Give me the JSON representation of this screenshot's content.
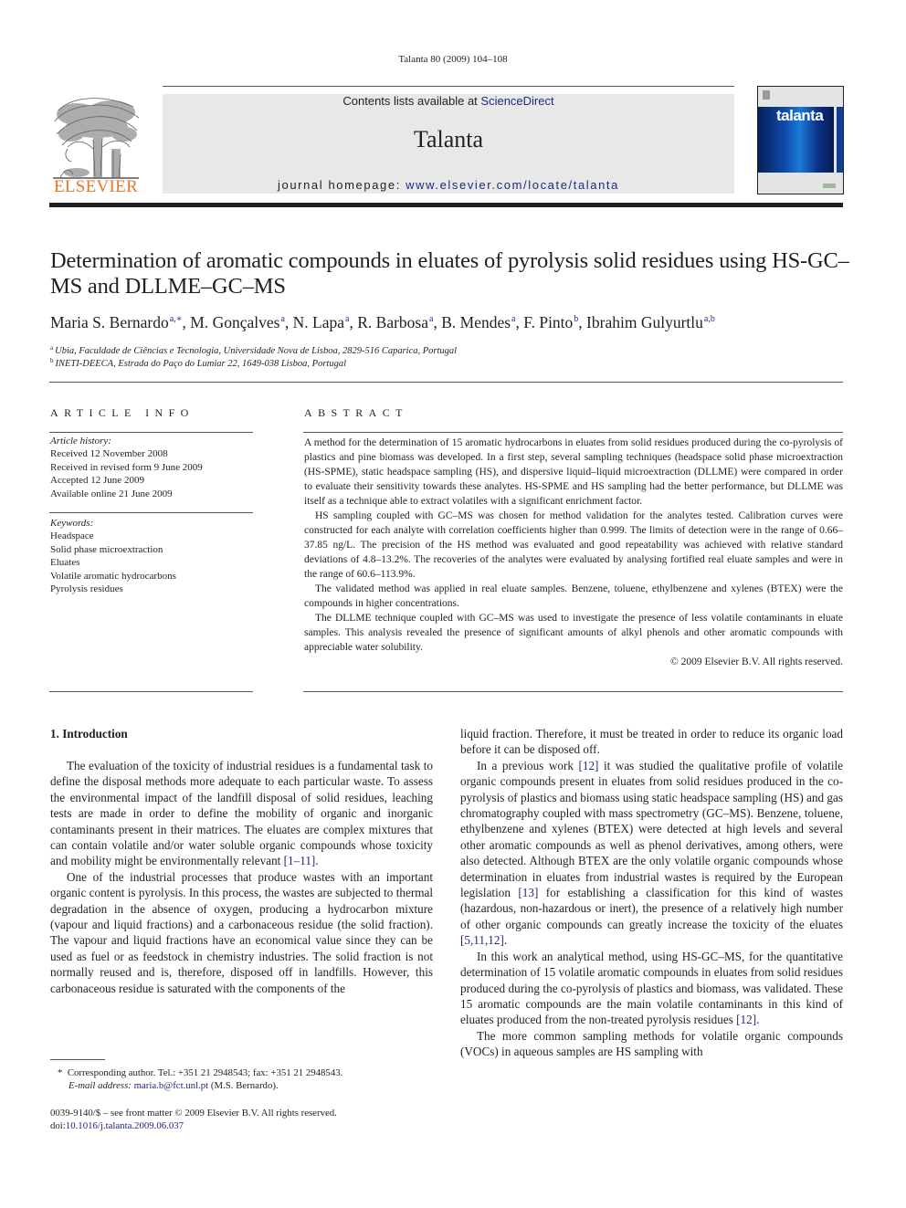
{
  "running_head": "Talanta 80 (2009) 104–108",
  "header": {
    "publisher_logo_text": "ELSEVIER",
    "contents_prefix": "Contents lists available at ",
    "contents_link": "ScienceDirect",
    "journal_name": "Talanta",
    "homepage_prefix": "journal homepage: ",
    "homepage_link": "www.elsevier.com/locate/talanta",
    "cover_title": "talanta",
    "colors": {
      "publisher_orange": "#e87722",
      "link_blue": "#1f2a80",
      "header_gray": "#e8e8e8"
    }
  },
  "article": {
    "title": "Determination of aromatic compounds in eluates of pyrolysis solid residues using HS-GC–MS and DLLME–GC–MS",
    "authors": [
      {
        "name": "Maria S. Bernardo",
        "sup": "a,∗",
        "sep": ", "
      },
      {
        "name": "M. Gonçalves",
        "sup": "a",
        "sep": ", "
      },
      {
        "name": "N. Lapa",
        "sup": "a",
        "sep": ", "
      },
      {
        "name": "R. Barbosa",
        "sup": "a",
        "sep": ", "
      },
      {
        "name": "B. Mendes",
        "sup": "a",
        "sep": ", "
      },
      {
        "name": "F. Pinto",
        "sup": "b",
        "sep": ", "
      },
      {
        "name": "Ibrahim Gulyurtlu",
        "sup": "a,b",
        "sep": ""
      }
    ],
    "affiliations": [
      {
        "mark": "a",
        "text": "Ubia, Faculdade de Ciências e Tecnologia, Universidade Nova de Lisboa, 2829-516 Caparica, Portugal"
      },
      {
        "mark": "b",
        "text": "INETI-DEECA, Estrada do Paço do Lumiar 22, 1649-038 Lisboa, Portugal"
      }
    ]
  },
  "article_info": {
    "heading": "ARTICLE INFO",
    "history_label": "Article history:",
    "history": [
      "Received 12 November 2008",
      "Received in revised form 9 June 2009",
      "Accepted 12 June 2009",
      "Available online 21 June 2009"
    ],
    "keywords_label": "Keywords:",
    "keywords": [
      "Headspace",
      "Solid phase microextraction",
      "Eluates",
      "Volatile aromatic hydrocarbons",
      "Pyrolysis residues"
    ]
  },
  "abstract": {
    "heading": "ABSTRACT",
    "paragraphs": [
      "A method for the determination of 15 aromatic hydrocarbons in eluates from solid residues produced during the co-pyrolysis of plastics and pine biomass was developed. In a first step, several sampling techniques (headspace solid phase microextraction (HS-SPME), static headspace sampling (HS), and dispersive liquid–liquid microextraction (DLLME) were compared in order to evaluate their sensitivity towards these analytes. HS-SPME and HS sampling had the better performance, but DLLME was itself as a technique able to extract volatiles with a significant enrichment factor.",
      "HS sampling coupled with GC–MS was chosen for method validation for the analytes tested. Calibration curves were constructed for each analyte with correlation coefficients higher than 0.999. The limits of detection were in the range of 0.66–37.85 ng/L. The precision of the HS method was evaluated and good repeatability was achieved with relative standard deviations of 4.8–13.2%. The recoveries of the analytes were evaluated by analysing fortified real eluate samples and were in the range of 60.6–113.9%.",
      "The validated method was applied in real eluate samples. Benzene, toluene, ethylbenzene and xylenes (BTEX) were the compounds in higher concentrations.",
      "The DLLME technique coupled with GC–MS was used to investigate the presence of less volatile contaminants in eluate samples. This analysis revealed the presence of significant amounts of alkyl phenols and other aromatic compounds with appreciable water solubility."
    ],
    "copyright": "© 2009 Elsevier B.V. All rights reserved."
  },
  "body": {
    "section_heading": "1.  Introduction",
    "left_paragraphs": [
      {
        "text": "The evaluation of the toxicity of industrial residues is a fundamental task to define the disposal methods more adequate to each particular waste. To assess the environmental impact of the landfill disposal of solid residues, leaching tests are made in order to define the mobility of organic and inorganic contaminants present in their matrices. The eluates are complex mixtures that can contain volatile and/or water soluble organic compounds whose toxicity and mobility might be environmentally relevant ",
        "ref": "[1–11]",
        "tail": "."
      },
      {
        "text": "One of the industrial processes that produce wastes with an important organic content is pyrolysis. In this process, the wastes are subjected to thermal degradation in the absence of oxygen, producing a hydrocarbon mixture (vapour and liquid fractions) and a carbonaceous residue (the solid fraction). The vapour and liquid fractions have an economical value since they can be used as fuel or as feedstock in chemistry industries. The solid fraction is not normally reused and is, therefore, disposed off in landfills. However, this carbonaceous residue is saturated with the components of the",
        "ref": "",
        "tail": ""
      }
    ],
    "right_continuation": "liquid fraction. Therefore, it must be treated in order to reduce its organic load before it can be disposed off.",
    "right_p1": {
      "a": "In a previous work ",
      "ref1": "[12]",
      "b": " it was studied the qualitative profile of volatile organic compounds present in eluates from solid residues produced in the co-pyrolysis of plastics and biomass using static headspace sampling (HS) and gas chromatography coupled with mass spectrometry (GC–MS). Benzene, toluene, ethylbenzene and xylenes (BTEX) were detected at high levels and several other aromatic compounds as well as phenol derivatives, among others, were also detected. Although BTEX are the only volatile organic compounds whose determination in eluates from industrial wastes is required by the European legislation ",
      "ref2": "[13]",
      "c": " for establishing a classification for this kind of wastes (hazardous, non-hazardous or inert), the presence of a relatively high number of other organic compounds can greatly increase the toxicity of the eluates ",
      "ref3": "[5,11,12]",
      "d": "."
    },
    "right_p2": {
      "a": "In this work an analytical method, using HS-GC–MS, for the quantitative determination of 15 volatile aromatic compounds in eluates from solid residues produced during the co-pyrolysis of plastics and biomass, was validated. These 15 aromatic compounds are the main volatile contaminants in this kind of eluates produced from the non-treated pyrolysis residues ",
      "ref": "[12]",
      "b": "."
    },
    "right_p3": "The more common sampling methods for volatile organic compounds (VOCs) in aqueous samples are HS sampling with"
  },
  "footnote": {
    "star": "*",
    "corresponding": "Corresponding author. Tel.: +351 21 2948543; fax: +351 21 2948543.",
    "email_label": "E-mail address: ",
    "email": "maria.b@fct.unl.pt",
    "email_suffix": " (M.S. Bernardo)."
  },
  "front_matter": {
    "issn_line": "0039-9140/$ – see front matter © 2009 Elsevier B.V. All rights reserved.",
    "doi_label": "doi:",
    "doi": "10.1016/j.talanta.2009.06.037"
  }
}
